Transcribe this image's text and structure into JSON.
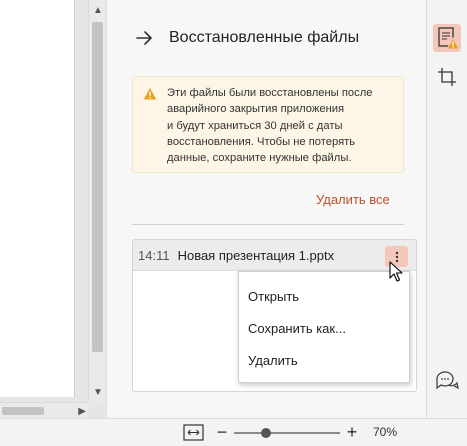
{
  "panel": {
    "title": "Восстановленные файлы",
    "warning_lines": [
      "Эти файлы были восстановлены после",
      "аварийного закрытия приложения",
      "и будут храниться 30 дней с даты",
      "восстановления. Чтобы не потерять",
      "данные, сохраните нужные файлы."
    ],
    "delete_all": "Удалить все",
    "file": {
      "time": "14:11",
      "name": "Новая презентация 1.pptx"
    },
    "menu": {
      "open": "Открыть",
      "save_as": "Сохранить как...",
      "delete": "Удалить"
    }
  },
  "status": {
    "zoom_value": "70%",
    "zoom_fraction": 0.3
  },
  "icons": {
    "back": "arrow-right-icon",
    "warning": "warning-triangle-icon",
    "more": "vertical-ellipsis-icon",
    "recovered": "document-warning-icon",
    "crop": "crop-icon",
    "comments": "comment-bubbles-icon",
    "fit": "fit-to-window-icon"
  },
  "colors": {
    "accent": "#c0502a",
    "highlight": "#f4c7bb",
    "warning_bg": "#fdf6e7",
    "warning_icon": "#e8a020"
  }
}
